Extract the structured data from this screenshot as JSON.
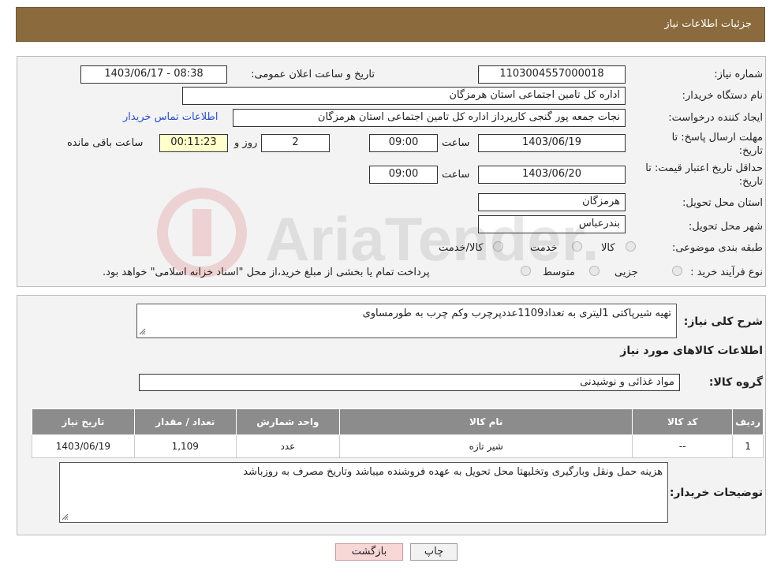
{
  "header": {
    "title": "جزئیات اطلاعات نیاز"
  },
  "form": {
    "need_number_label": "شماره نیاز:",
    "need_number": "1103004557000018",
    "announce_label": "تاریخ و ساعت اعلان عمومی:",
    "announce_value": "1403/06/17 - 08:38",
    "buyer_org_label": "نام دستگاه خریدار:",
    "buyer_org": "اداره کل تامین اجتماعی استان هرمزگان",
    "creator_label": "ایجاد کننده درخواست:",
    "creator": "نجات جمعه پور گنجی  کارپرداز اداره کل تامین اجتماعی استان هرمزگان",
    "contact_link": "اطلاعات تماس خریدار",
    "deadline_label_1": "مهلت ارسال پاسخ: تا",
    "deadline_label_2": "تاریخ:",
    "deadline_date": "1403/06/19",
    "time_label": "ساعت",
    "deadline_time": "09:00",
    "days_value": "2",
    "days_label": "روز و",
    "remaining_time": "00:11:23",
    "remaining_label": "ساعت باقی مانده",
    "validity_label_1": "حداقل تاریخ اعتبار قیمت: تا",
    "validity_label_2": "تاریخ:",
    "validity_date": "1403/06/20",
    "validity_time": "09:00",
    "province_label": "استان محل تحویل:",
    "province": "هرمزگان",
    "city_label": "شهر محل تحویل:",
    "city": "بندرعباس",
    "category_label": "طبقه بندی موضوعی:",
    "category_options": [
      "کالا",
      "خدمت",
      "کالا/خدمت"
    ],
    "process_label": "نوع فرآیند خرید :",
    "process_options": [
      "جزیی",
      "متوسط"
    ],
    "payment_note": "پرداخت تمام یا بخشی از مبلغ خرید،از محل \"اسناد خزانه اسلامی\" خواهد بود."
  },
  "details": {
    "description_label": "شرح کلی نیاز:",
    "description": "تهیه شیرپاکتی 1لیتری به تعداد1109عددپرچرب وکم چرب به طورمساوی",
    "goods_info_title": "اطلاعات کالاهای مورد نیاز",
    "goods_group_label": "گروه کالا:",
    "goods_group": "مواد غذائی و نوشیدنی",
    "table": {
      "headers": [
        "ردیف",
        "کد کالا",
        "نام کالا",
        "واحد شمارش",
        "تعداد / مقدار",
        "تاریخ نیاز"
      ],
      "rows": [
        [
          "1",
          "--",
          "شیر تازه",
          "عدد",
          "1,109",
          "1403/06/19"
        ]
      ]
    },
    "buyer_notes_label": "توضیحات خریدار:",
    "buyer_notes": "هزینه حمل ونقل وبارگیری وتخلیهتا محل تحویل  به عهده فروشنده میباشد وتاریخ مصرف به روزباشد"
  },
  "buttons": {
    "print": "چاپ",
    "back": "بازگشت"
  },
  "watermark": {
    "text": "AriaTender.neT"
  },
  "colors": {
    "header_bg": "#8b6b3d",
    "link": "#2a4fd6",
    "remaining_bg": "#ffffcc",
    "table_header": "#8c8c8c",
    "back_button_bg": "#f8d7d7"
  }
}
